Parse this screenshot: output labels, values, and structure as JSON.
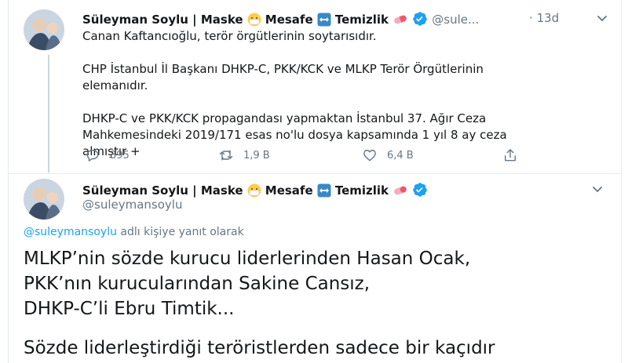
{
  "tweet1": {
    "name": "Süleyman Soylu | Maske",
    "name_mesafe": "Mesafe",
    "name_temizlik": "Temizlik",
    "handle": "@sule...",
    "separator": "·",
    "time": "13d",
    "paragraphs": [
      "Canan Kaftancıoğlu, terör örgütlerinin soytarısıdır.",
      "CHP İstanbul İl Başkanı DHKP-C, PKK/KCK ve MLKP Terör Örgütlerinin",
      "elemanıdır.",
      "DHKP-C ve PKK/KCK propagandası yapmaktan İstanbul 37. Ağır Ceza",
      "Mahkemesindeki 2019/171 esas no'lu dosya kapsamında 1 yıl 8 ay ceza",
      "almıştır +"
    ],
    "actions": {
      "reply_count": "395",
      "retweet_count": "1,9 B",
      "like_count": "6,4 B"
    }
  },
  "tweet2": {
    "name": "Süleyman Soylu | Maske",
    "name_mesafe": "Mesafe",
    "name_temizlik": "Temizlik",
    "handle": "@suleymansoylu",
    "reply_mention": "@suleymansoylu",
    "reply_suffix": " adlı kişiye yanıt olarak",
    "lines": [
      "MLKP’nin sözde kurucu liderlerinden Hasan Ocak,",
      "PKK’nın kurucularından Sakine Cansız,",
      "DHKP-C’li Ebru Timtik...",
      "Sözde liderleştirdiği teröristlerden sadece bir kaçıdır"
    ]
  },
  "colors": {
    "accent": "#1da1f2",
    "muted": "#657786",
    "text": "#14171a"
  },
  "icons": [
    "verified-badge",
    "mask-emoji",
    "left-right-arrow-emoji",
    "pill-emoji",
    "chevron-down",
    "reply",
    "retweet",
    "like",
    "share"
  ]
}
